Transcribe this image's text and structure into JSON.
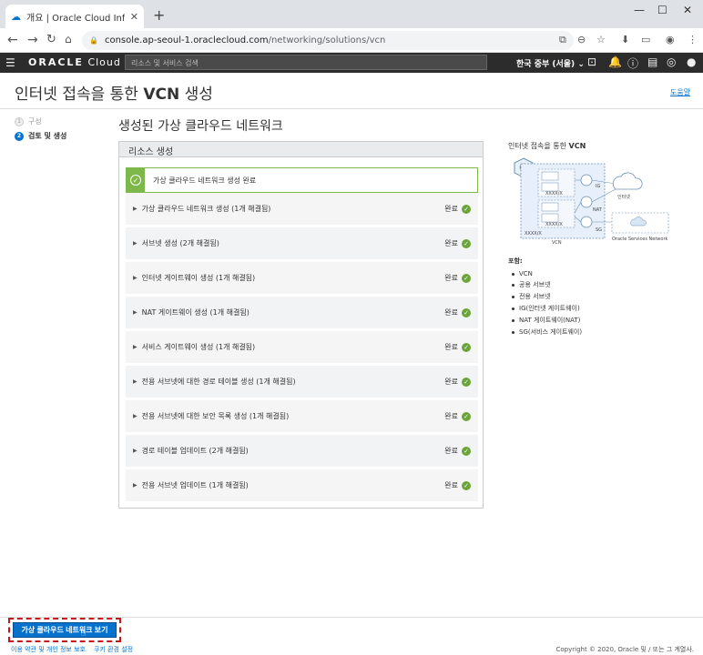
{
  "browser": {
    "tab_title": "개요 | Oracle Cloud Infrastructu",
    "url_host": "console.ap-seoul-1.oraclecloud.com",
    "url_path": "/networking/solutions/vcn"
  },
  "header": {
    "logo_oracle": "ORACLE",
    "logo_cloud": "Cloud",
    "search_placeholder": "리소스 및 서비스 검색",
    "region": "한국 중부 (서울)"
  },
  "page": {
    "title_prefix": "인터넷 접속을 통한",
    "title_bold": "VCN",
    "title_suffix": "생성",
    "help_link": "도움말"
  },
  "steps": [
    {
      "num": "1",
      "label": "구성"
    },
    {
      "num": "2",
      "label": "검토 및 생성"
    }
  ],
  "main": {
    "heading": "생성된 가상 클라우드 네트워크",
    "panel_title": "리소스 생성",
    "banner_text": "가상 클라우드 네트워크 생성 완료",
    "tasks": [
      {
        "label": "가상 클라우드 네트워크 생성 (1개 해결됨)",
        "status": "완료"
      },
      {
        "label": "서브넷 생성 (2개 해결됨)",
        "status": "완료"
      },
      {
        "label": "인터넷 게이트웨이 생성 (1개 해결됨)",
        "status": "완료"
      },
      {
        "label": "NAT 게이트웨이 생성 (1개 해결됨)",
        "status": "완료"
      },
      {
        "label": "서비스 게이트웨이 생성 (1개 해결됨)",
        "status": "완료"
      },
      {
        "label": "전용 서브넷에 대한 경로 테이블 생성 (1개 해결됨)",
        "status": "완료"
      },
      {
        "label": "전용 서브넷에 대한 보안 목록 생성 (1개 해결됨)",
        "status": "완료"
      },
      {
        "label": "경로 테이블 업데이트 (2개 해결됨)",
        "status": "완료"
      },
      {
        "label": "전용 서브넷 업데이트 (1개 해결됨)",
        "status": "완료"
      }
    ]
  },
  "side": {
    "title_prefix": "인터넷 접속을 통한",
    "title_bold": "VCN",
    "diagram_labels": {
      "subnet_a": "XXXX/X",
      "subnet_b": "XXXX/X",
      "cidr": "XXXX/X",
      "vcn": "VCN",
      "ig": "IG",
      "nat": "NAT",
      "sg": "SG",
      "internet": "인터넷",
      "oracle_services": "Oracle Services Network"
    },
    "includes_label": "포함:",
    "includes": [
      "VCN",
      "공용 서브넷",
      "전용 서브넷",
      "IG(인터넷 게이트웨이)",
      "NAT 게이트웨이(NAT)",
      "SG(서비스 게이트웨이)"
    ]
  },
  "footer": {
    "view_button": "가상 클라우드 네트워크 보기",
    "terms_link": "이용 약관 및 개인 정보 보호",
    "cookie_link": "쿠키 환경 설정",
    "copyright": "Copyright © 2020, Oracle 및 / 또는 그 계열사."
  },
  "colors": {
    "accent": "#0572ce",
    "success": "#6ba539",
    "header_bg": "#2c2c2c",
    "highlight": "#c4161c"
  }
}
